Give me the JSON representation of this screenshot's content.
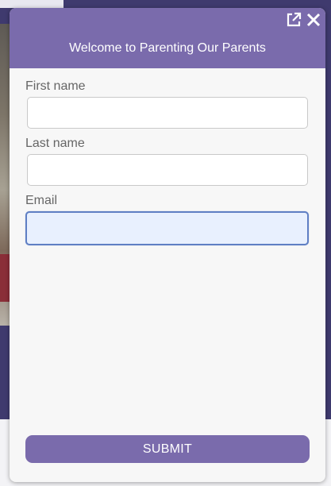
{
  "widget": {
    "title": "Welcome to Parenting Our Parents",
    "header_icons": [
      "popout-icon",
      "close-icon"
    ],
    "accent_color": "#7a6bac"
  },
  "form": {
    "first_name": {
      "label": "First name",
      "value": ""
    },
    "last_name": {
      "label": "Last name",
      "value": ""
    },
    "email": {
      "label": "Email",
      "value": "",
      "focused": true
    }
  },
  "submit": {
    "label": "SUBMIT"
  }
}
